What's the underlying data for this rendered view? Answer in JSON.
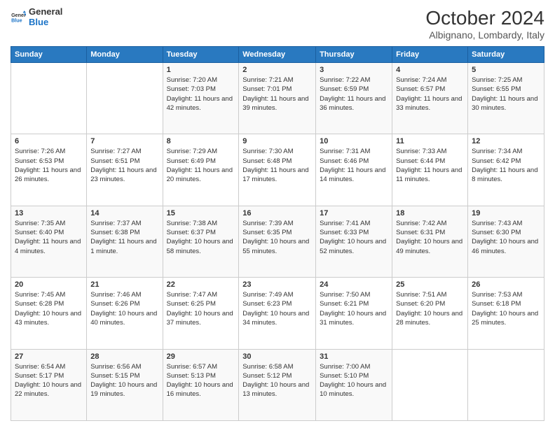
{
  "logo": {
    "line1": "General",
    "line2": "Blue",
    "icon_color": "#1a73c7"
  },
  "header": {
    "month_year": "October 2024",
    "location": "Albignano, Lombardy, Italy"
  },
  "weekdays": [
    "Sunday",
    "Monday",
    "Tuesday",
    "Wednesday",
    "Thursday",
    "Friday",
    "Saturday"
  ],
  "weeks": [
    [
      {
        "day": "",
        "info": ""
      },
      {
        "day": "",
        "info": ""
      },
      {
        "day": "1",
        "info": "Sunrise: 7:20 AM\nSunset: 7:03 PM\nDaylight: 11 hours and 42 minutes."
      },
      {
        "day": "2",
        "info": "Sunrise: 7:21 AM\nSunset: 7:01 PM\nDaylight: 11 hours and 39 minutes."
      },
      {
        "day": "3",
        "info": "Sunrise: 7:22 AM\nSunset: 6:59 PM\nDaylight: 11 hours and 36 minutes."
      },
      {
        "day": "4",
        "info": "Sunrise: 7:24 AM\nSunset: 6:57 PM\nDaylight: 11 hours and 33 minutes."
      },
      {
        "day": "5",
        "info": "Sunrise: 7:25 AM\nSunset: 6:55 PM\nDaylight: 11 hours and 30 minutes."
      }
    ],
    [
      {
        "day": "6",
        "info": "Sunrise: 7:26 AM\nSunset: 6:53 PM\nDaylight: 11 hours and 26 minutes."
      },
      {
        "day": "7",
        "info": "Sunrise: 7:27 AM\nSunset: 6:51 PM\nDaylight: 11 hours and 23 minutes."
      },
      {
        "day": "8",
        "info": "Sunrise: 7:29 AM\nSunset: 6:49 PM\nDaylight: 11 hours and 20 minutes."
      },
      {
        "day": "9",
        "info": "Sunrise: 7:30 AM\nSunset: 6:48 PM\nDaylight: 11 hours and 17 minutes."
      },
      {
        "day": "10",
        "info": "Sunrise: 7:31 AM\nSunset: 6:46 PM\nDaylight: 11 hours and 14 minutes."
      },
      {
        "day": "11",
        "info": "Sunrise: 7:33 AM\nSunset: 6:44 PM\nDaylight: 11 hours and 11 minutes."
      },
      {
        "day": "12",
        "info": "Sunrise: 7:34 AM\nSunset: 6:42 PM\nDaylight: 11 hours and 8 minutes."
      }
    ],
    [
      {
        "day": "13",
        "info": "Sunrise: 7:35 AM\nSunset: 6:40 PM\nDaylight: 11 hours and 4 minutes."
      },
      {
        "day": "14",
        "info": "Sunrise: 7:37 AM\nSunset: 6:38 PM\nDaylight: 11 hours and 1 minute."
      },
      {
        "day": "15",
        "info": "Sunrise: 7:38 AM\nSunset: 6:37 PM\nDaylight: 10 hours and 58 minutes."
      },
      {
        "day": "16",
        "info": "Sunrise: 7:39 AM\nSunset: 6:35 PM\nDaylight: 10 hours and 55 minutes."
      },
      {
        "day": "17",
        "info": "Sunrise: 7:41 AM\nSunset: 6:33 PM\nDaylight: 10 hours and 52 minutes."
      },
      {
        "day": "18",
        "info": "Sunrise: 7:42 AM\nSunset: 6:31 PM\nDaylight: 10 hours and 49 minutes."
      },
      {
        "day": "19",
        "info": "Sunrise: 7:43 AM\nSunset: 6:30 PM\nDaylight: 10 hours and 46 minutes."
      }
    ],
    [
      {
        "day": "20",
        "info": "Sunrise: 7:45 AM\nSunset: 6:28 PM\nDaylight: 10 hours and 43 minutes."
      },
      {
        "day": "21",
        "info": "Sunrise: 7:46 AM\nSunset: 6:26 PM\nDaylight: 10 hours and 40 minutes."
      },
      {
        "day": "22",
        "info": "Sunrise: 7:47 AM\nSunset: 6:25 PM\nDaylight: 10 hours and 37 minutes."
      },
      {
        "day": "23",
        "info": "Sunrise: 7:49 AM\nSunset: 6:23 PM\nDaylight: 10 hours and 34 minutes."
      },
      {
        "day": "24",
        "info": "Sunrise: 7:50 AM\nSunset: 6:21 PM\nDaylight: 10 hours and 31 minutes."
      },
      {
        "day": "25",
        "info": "Sunrise: 7:51 AM\nSunset: 6:20 PM\nDaylight: 10 hours and 28 minutes."
      },
      {
        "day": "26",
        "info": "Sunrise: 7:53 AM\nSunset: 6:18 PM\nDaylight: 10 hours and 25 minutes."
      }
    ],
    [
      {
        "day": "27",
        "info": "Sunrise: 6:54 AM\nSunset: 5:17 PM\nDaylight: 10 hours and 22 minutes."
      },
      {
        "day": "28",
        "info": "Sunrise: 6:56 AM\nSunset: 5:15 PM\nDaylight: 10 hours and 19 minutes."
      },
      {
        "day": "29",
        "info": "Sunrise: 6:57 AM\nSunset: 5:13 PM\nDaylight: 10 hours and 16 minutes."
      },
      {
        "day": "30",
        "info": "Sunrise: 6:58 AM\nSunset: 5:12 PM\nDaylight: 10 hours and 13 minutes."
      },
      {
        "day": "31",
        "info": "Sunrise: 7:00 AM\nSunset: 5:10 PM\nDaylight: 10 hours and 10 minutes."
      },
      {
        "day": "",
        "info": ""
      },
      {
        "day": "",
        "info": ""
      }
    ]
  ]
}
